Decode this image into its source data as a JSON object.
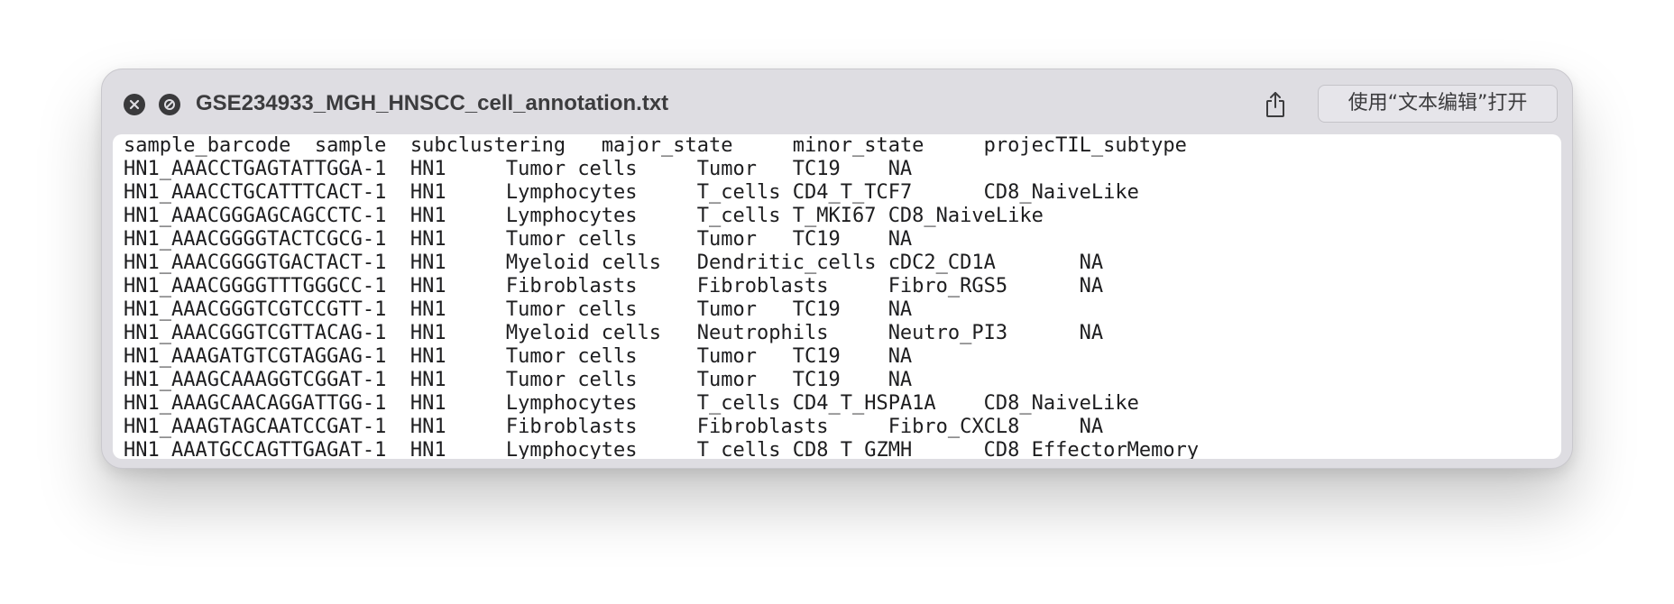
{
  "window": {
    "title": "GSE234933_MGH_HNSCC_cell_annotation.txt",
    "open_with_label": "使用“文本编辑”打开",
    "controls": [
      "close-icon",
      "disabled-icon"
    ],
    "share_icon": "share-icon"
  },
  "file": {
    "lines": [
      [
        "sample_barcode",
        "sample",
        "subclustering",
        "major_state",
        "minor_state",
        "projecTIL_subtype"
      ],
      [
        "HN1_AAACCTGAGTATTGGA-1",
        "HN1",
        "Tumor cells",
        "Tumor",
        "TC19",
        "NA"
      ],
      [
        "HN1_AAACCTGCATTTCACT-1",
        "HN1",
        "Lymphocytes",
        "T_cells",
        "CD4_T_TCF7",
        "CD8_NaiveLike"
      ],
      [
        "HN1_AAACGGGAGCAGCCTC-1",
        "HN1",
        "Lymphocytes",
        "T_cells",
        "T_MKI67",
        "CD8_NaiveLike"
      ],
      [
        "HN1_AAACGGGGTACTCGCG-1",
        "HN1",
        "Tumor cells",
        "Tumor",
        "TC19",
        "NA"
      ],
      [
        "HN1_AAACGGGGTGACTACT-1",
        "HN1",
        "Myeloid cells",
        "Dendritic_cells",
        "cDC2_CD1A",
        "NA"
      ],
      [
        "HN1_AAACGGGGTTTGGGCC-1",
        "HN1",
        "Fibroblasts",
        "Fibroblasts",
        "Fibro_RGS5",
        "NA"
      ],
      [
        "HN1_AAACGGGTCGTCCGTT-1",
        "HN1",
        "Tumor cells",
        "Tumor",
        "TC19",
        "NA"
      ],
      [
        "HN1_AAACGGGTCGTTACAG-1",
        "HN1",
        "Myeloid cells",
        "Neutrophils",
        "Neutro_PI3",
        "NA"
      ],
      [
        "HN1_AAAGATGTCGTAGGAG-1",
        "HN1",
        "Tumor cells",
        "Tumor",
        "TC19",
        "NA"
      ],
      [
        "HN1_AAAGCAAAGGTCGGAT-1",
        "HN1",
        "Tumor cells",
        "Tumor",
        "TC19",
        "NA"
      ],
      [
        "HN1_AAAGCAACAGGATTGG-1",
        "HN1",
        "Lymphocytes",
        "T_cells",
        "CD4_T_HSPA1A",
        "CD8_NaiveLike"
      ],
      [
        "HN1_AAAGTAGCAATCCGAT-1",
        "HN1",
        "Fibroblasts",
        "Fibroblasts",
        "Fibro_CXCL8",
        "NA"
      ],
      [
        "HN1_AAATGCCAGTTGAGAT-1",
        "HN1",
        "Lymphocytes",
        "T_cells",
        "CD8_T_GZMH",
        "CD8_EffectorMemory"
      ]
    ]
  }
}
